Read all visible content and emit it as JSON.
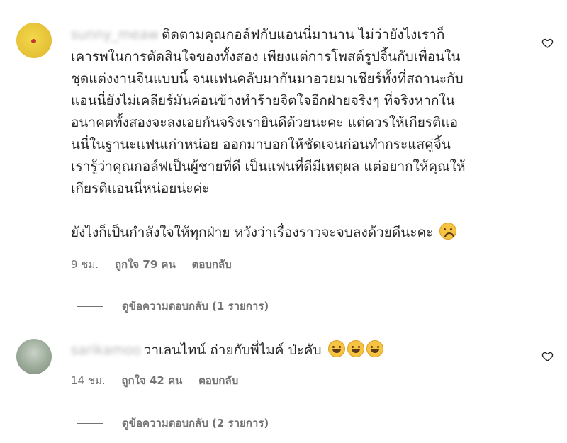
{
  "comments": [
    {
      "username": "sunny_meaw",
      "text": "ติดตามคุณกอล์ฟกับแอนนี่มานาน ไม่ว่ายังไงเราก็\nเคารพในการตัดสินใจของทั้งสอง เพียงแต่การโพสต์รูปจิ้นกับเพื่อนใน\nชุดแต่งงานจีนแบบนี้ จนแฟนคลับมากันมาอวยมาเชียร์ทั้งที่สถานะกับ\nแอนนี่ยังไม่เคลียร์มันค่อนข้างทำร้ายจิตใจอีกฝ่ายจริงๆ ที่จริงหากใน\nอนาคตทั้งสองจะลงเอยกันจริงเรายินดีด้วยนะคะ แต่ควรให้เกียรติแอ\nนนี่ในฐานะแฟนเก่าหน่อย ออกมาบอกให้ชัดเจนก่อนทำกระแสคู่จิ้น\nเรารู้ว่าคุณกอล์ฟเป็นผู้ชายที่ดี เป็นแฟนที่ดีมีเหตุผล แต่อยากให้คุณให้\nเกียรติแอนนี่หน่อยน่ะค่ะ\n\nยังไงก็เป็นกำลังใจให้ทุกฝ่าย หวังว่าเรื่องราวจะจบลงด้วยดีนะคะ",
      "emoji": "sad-face-emoji",
      "time": "9 ชม.",
      "likes": "ถูกใจ 79 คน",
      "reply": "ตอบกลับ",
      "view_replies": "ดูข้อความตอบกลับ (1 รายการ)"
    },
    {
      "username": "sarikamoo",
      "text": "วาเลนไทน์ ถ่ายกับพี่ไมค์ ป่ะคับ",
      "emoji": "tears-of-joy-emoji",
      "time": "14 ชม.",
      "likes": "ถูกใจ 42 คน",
      "reply": "ตอบกลับ",
      "view_replies": "ดูข้อความตอบกลับ (2 รายการ)"
    }
  ],
  "icons": {
    "like": "heart-icon"
  }
}
